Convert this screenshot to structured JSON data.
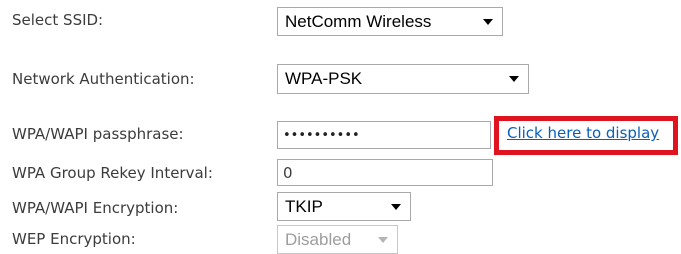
{
  "form": {
    "ssid": {
      "label": "Select SSID:",
      "value": "NetComm Wireless"
    },
    "auth": {
      "label": "Network Authentication:",
      "value": "WPA-PSK"
    },
    "passphrase": {
      "label": "WPA/WAPI passphrase:",
      "value": "••••••••••",
      "display_link": "Click here to display"
    },
    "rekey": {
      "label": "WPA Group Rekey Interval:",
      "value": "0"
    },
    "encryption": {
      "label": "WPA/WAPI Encryption:",
      "value": "TKIP"
    },
    "wep": {
      "label": "WEP Encryption:",
      "value": "Disabled"
    }
  },
  "colors": {
    "highlight": "#e0141e",
    "link": "#0b5fb8"
  }
}
